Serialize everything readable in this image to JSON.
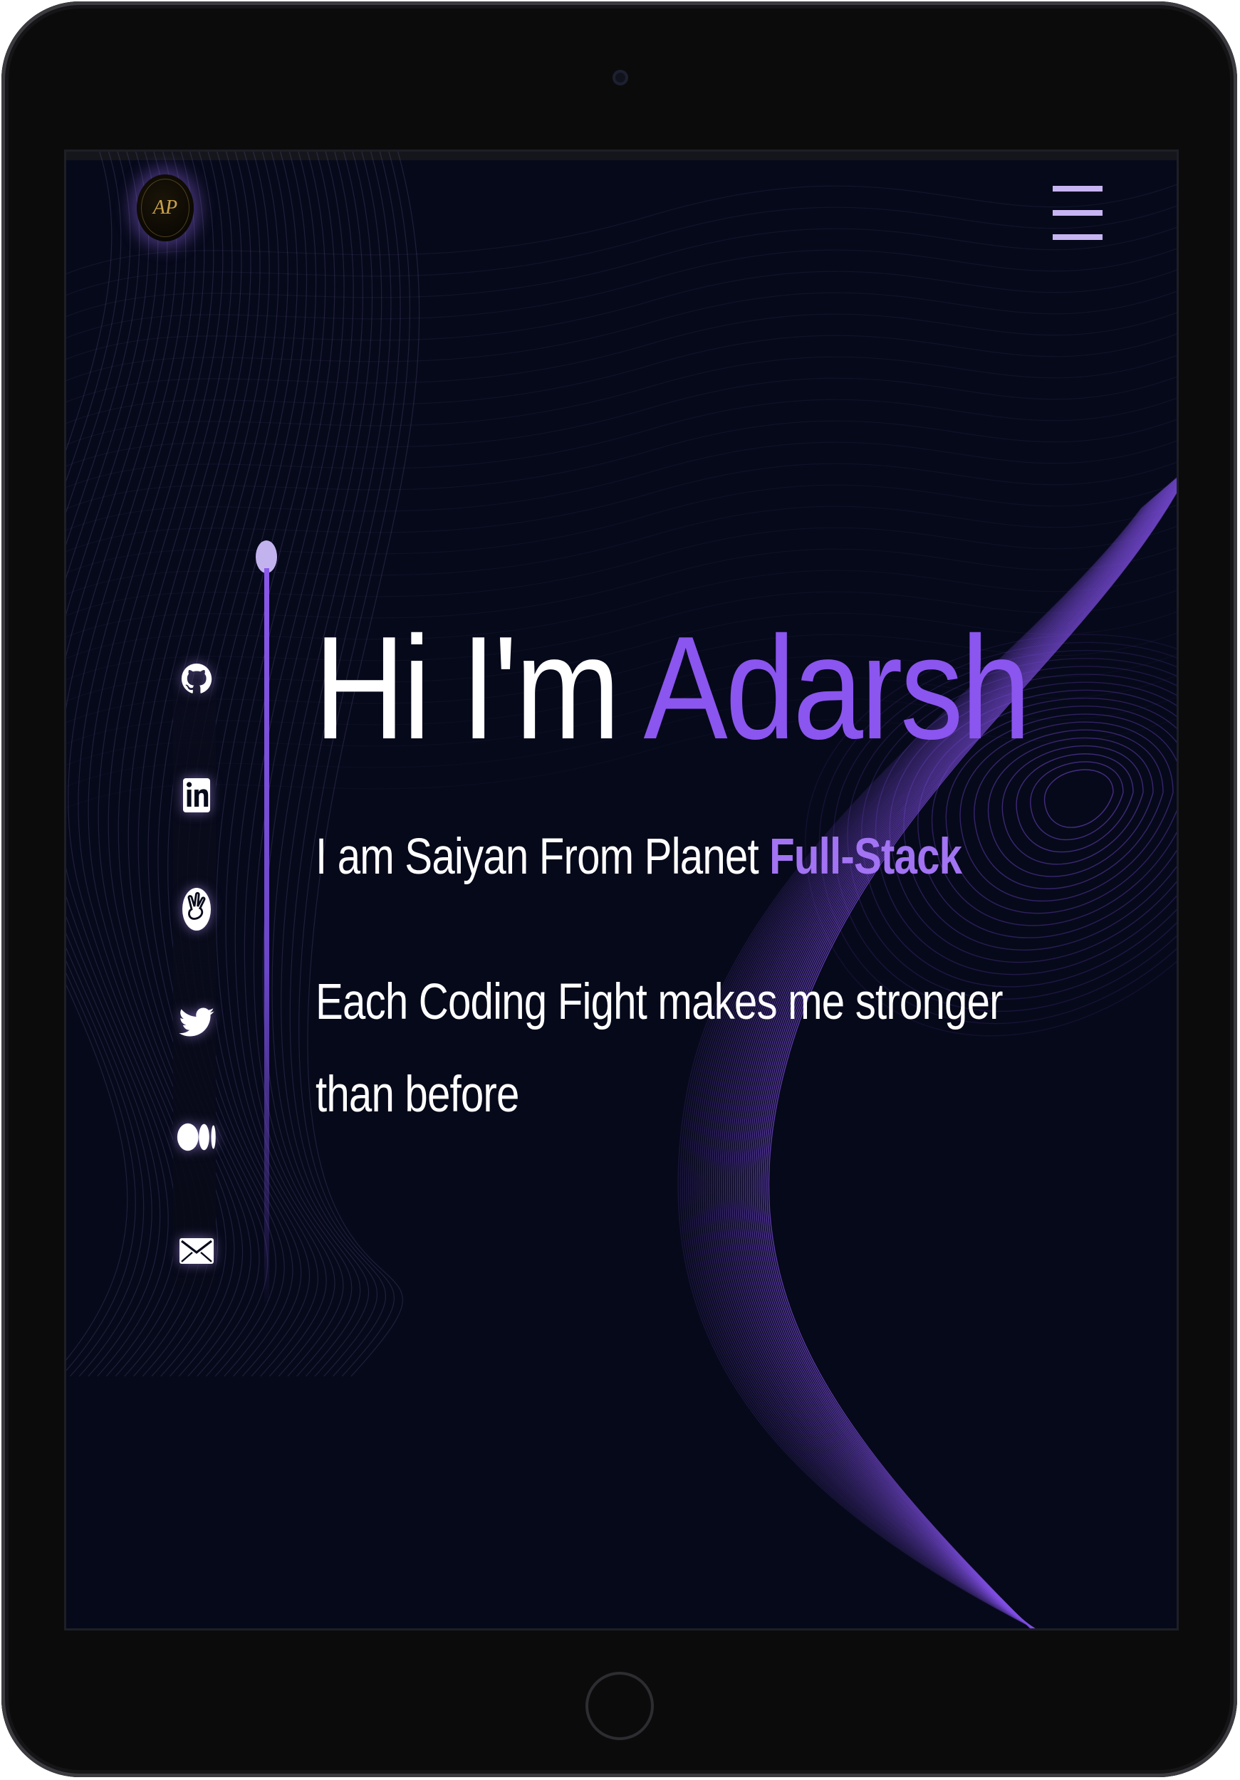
{
  "page": {
    "background_color": "#06091a",
    "accent_color": "#8b55ef"
  },
  "header": {
    "logo_text": "AP",
    "logo_icon": "monogram-logo",
    "menu_icon": "hamburger-menu-icon"
  },
  "hero": {
    "greeting": "Hi I'm ",
    "name": "Adarsh",
    "tagline_prefix": "I am Saiyan From Planet ",
    "tagline_highlight": "Full-Stack",
    "motto": "Each Coding Fight makes me stronger than before"
  },
  "social": {
    "icons": [
      "github-icon",
      "linkedin-icon",
      "angellist-icon",
      "twitter-icon",
      "medium-icon",
      "mail-icon"
    ]
  },
  "device": {
    "frame_color": "#0b0b0c"
  }
}
